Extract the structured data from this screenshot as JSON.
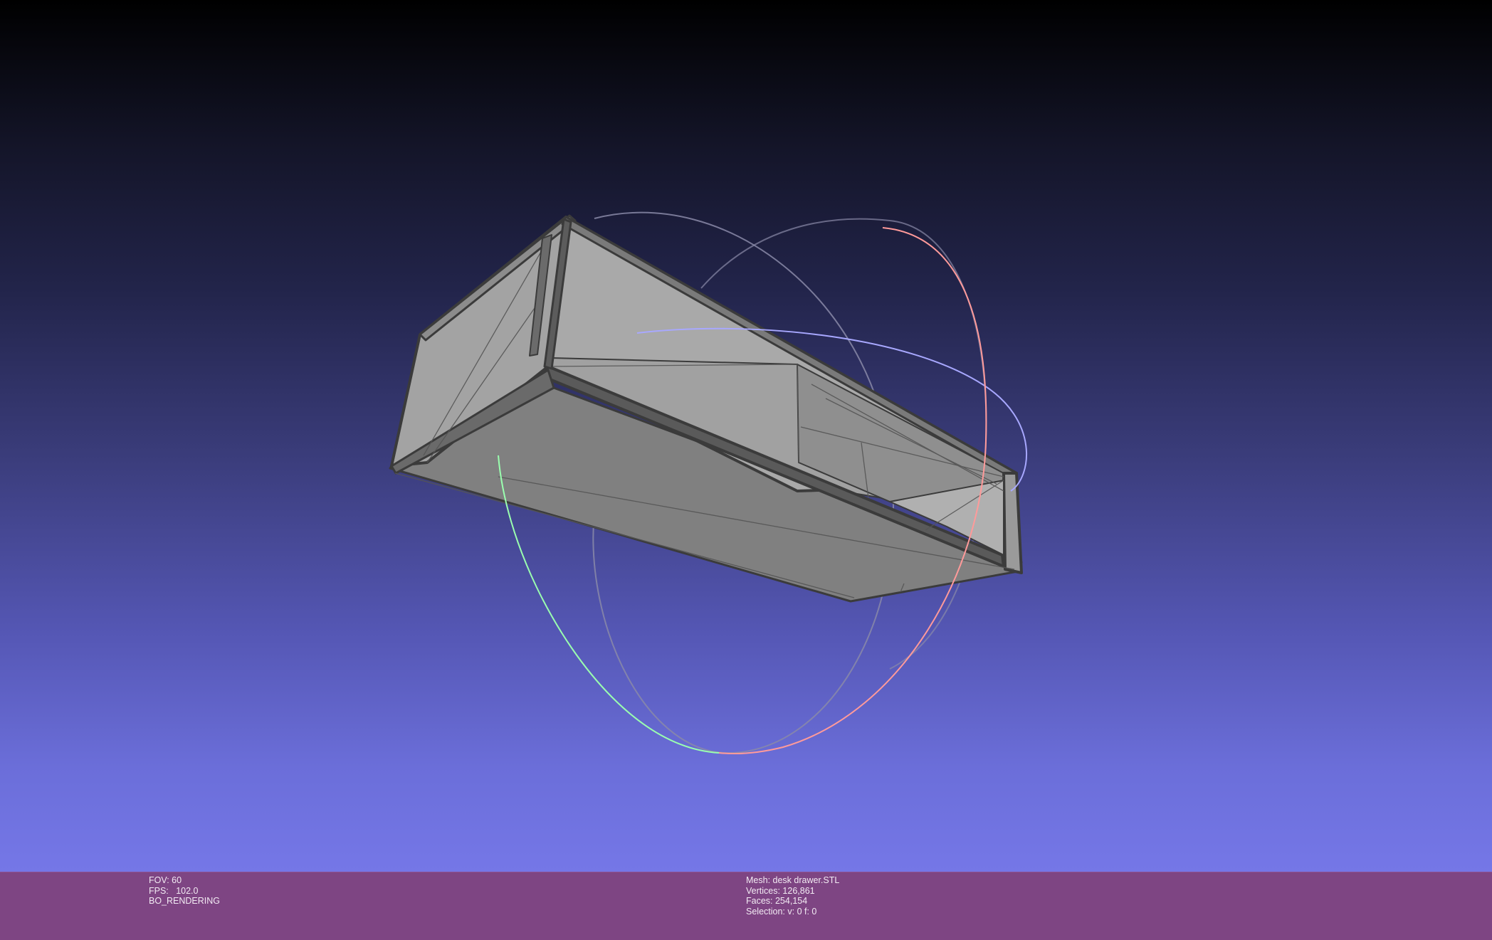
{
  "viewer": {
    "model_fill": "#a9a9a9",
    "model_dark": "#808080",
    "edge_color": "#3b3b3b",
    "trackball_colors": {
      "red": "#ff9a9a",
      "green": "#9affaf",
      "blue": "#a8a8ff"
    }
  },
  "info_left": {
    "fov": "FOV: 60",
    "fps": "FPS:   102.0",
    "mode": "BO_RENDERING"
  },
  "info_right": {
    "mesh": "Mesh: desk drawer.STL",
    "vertices": "Vertices: 126,861",
    "faces": "Faces: 254,154",
    "selection": "Selection: v: 0 f: 0"
  }
}
